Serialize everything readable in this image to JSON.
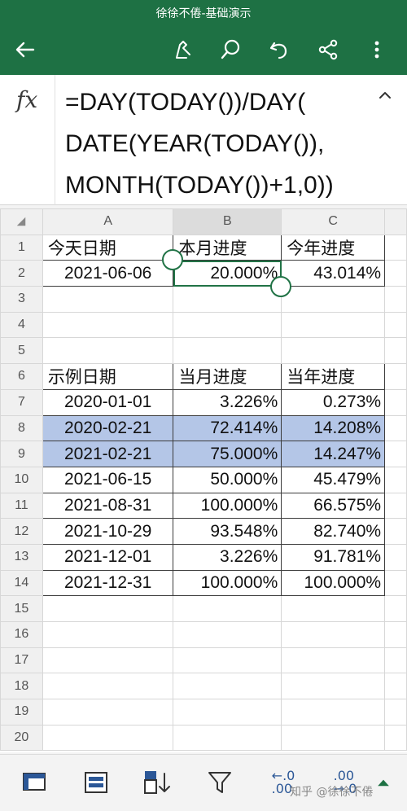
{
  "app": {
    "title": "徐徐不倦-基础演示"
  },
  "toolbar": {
    "icons": [
      "back-arrow-icon",
      "pen-icon",
      "search-icon",
      "undo-icon",
      "share-icon",
      "more-icon"
    ]
  },
  "formula_bar": {
    "fx_label": "fx",
    "formula": "=DAY(TODAY())/DAY(\nDATE(YEAR(TODAY()),\nMONTH(TODAY())+1,0))"
  },
  "sheet": {
    "columns": [
      "A",
      "B",
      "C"
    ],
    "rows": [
      {
        "n": "1",
        "a": "今天日期",
        "b": "本月进度",
        "c": "今年进度"
      },
      {
        "n": "2",
        "a": "2021-06-06",
        "b": "20.000%",
        "c": "43.014%"
      },
      {
        "n": "3",
        "a": "",
        "b": "",
        "c": ""
      },
      {
        "n": "4",
        "a": "",
        "b": "",
        "c": ""
      },
      {
        "n": "5",
        "a": "",
        "b": "",
        "c": ""
      },
      {
        "n": "6",
        "a": "示例日期",
        "b": "当月进度",
        "c": "当年进度"
      },
      {
        "n": "7",
        "a": "2020-01-01",
        "b": "3.226%",
        "c": "0.273%"
      },
      {
        "n": "8",
        "a": "2020-02-21",
        "b": "72.414%",
        "c": "14.208%"
      },
      {
        "n": "9",
        "a": "2021-02-21",
        "b": "75.000%",
        "c": "14.247%"
      },
      {
        "n": "10",
        "a": "2021-06-15",
        "b": "50.000%",
        "c": "45.479%"
      },
      {
        "n": "11",
        "a": "2021-08-31",
        "b": "100.000%",
        "c": "66.575%"
      },
      {
        "n": "12",
        "a": "2021-10-29",
        "b": "93.548%",
        "c": "82.740%"
      },
      {
        "n": "13",
        "a": "2021-12-01",
        "b": "3.226%",
        "c": "91.781%"
      },
      {
        "n": "14",
        "a": "2021-12-31",
        "b": "100.000%",
        "c": "100.000%"
      },
      {
        "n": "15",
        "a": "",
        "b": "",
        "c": ""
      },
      {
        "n": "16",
        "a": "",
        "b": "",
        "c": ""
      },
      {
        "n": "17",
        "a": "",
        "b": "",
        "c": ""
      },
      {
        "n": "18",
        "a": "",
        "b": "",
        "c": ""
      },
      {
        "n": "19",
        "a": "",
        "b": "",
        "c": ""
      },
      {
        "n": "20",
        "a": "",
        "b": "",
        "c": ""
      }
    ],
    "selected_cell": "B2",
    "highlight_rows": [
      "8",
      "9"
    ]
  },
  "bottom_toolbar": {
    "increase_decimal_label": ".00\n→.0",
    "decrease_decimal_label": "←.0\n.00",
    "icons": [
      "freeze-panes-icon",
      "format-icon",
      "sort-icon",
      "filter-icon",
      "decrease-decimal-icon",
      "increase-decimal-icon",
      "expand-icon"
    ]
  },
  "watermark": "知乎 @徐徐不倦",
  "colors": {
    "brand": "#1e7144",
    "highlight": "#b4c6e7",
    "selection": "#217346"
  }
}
